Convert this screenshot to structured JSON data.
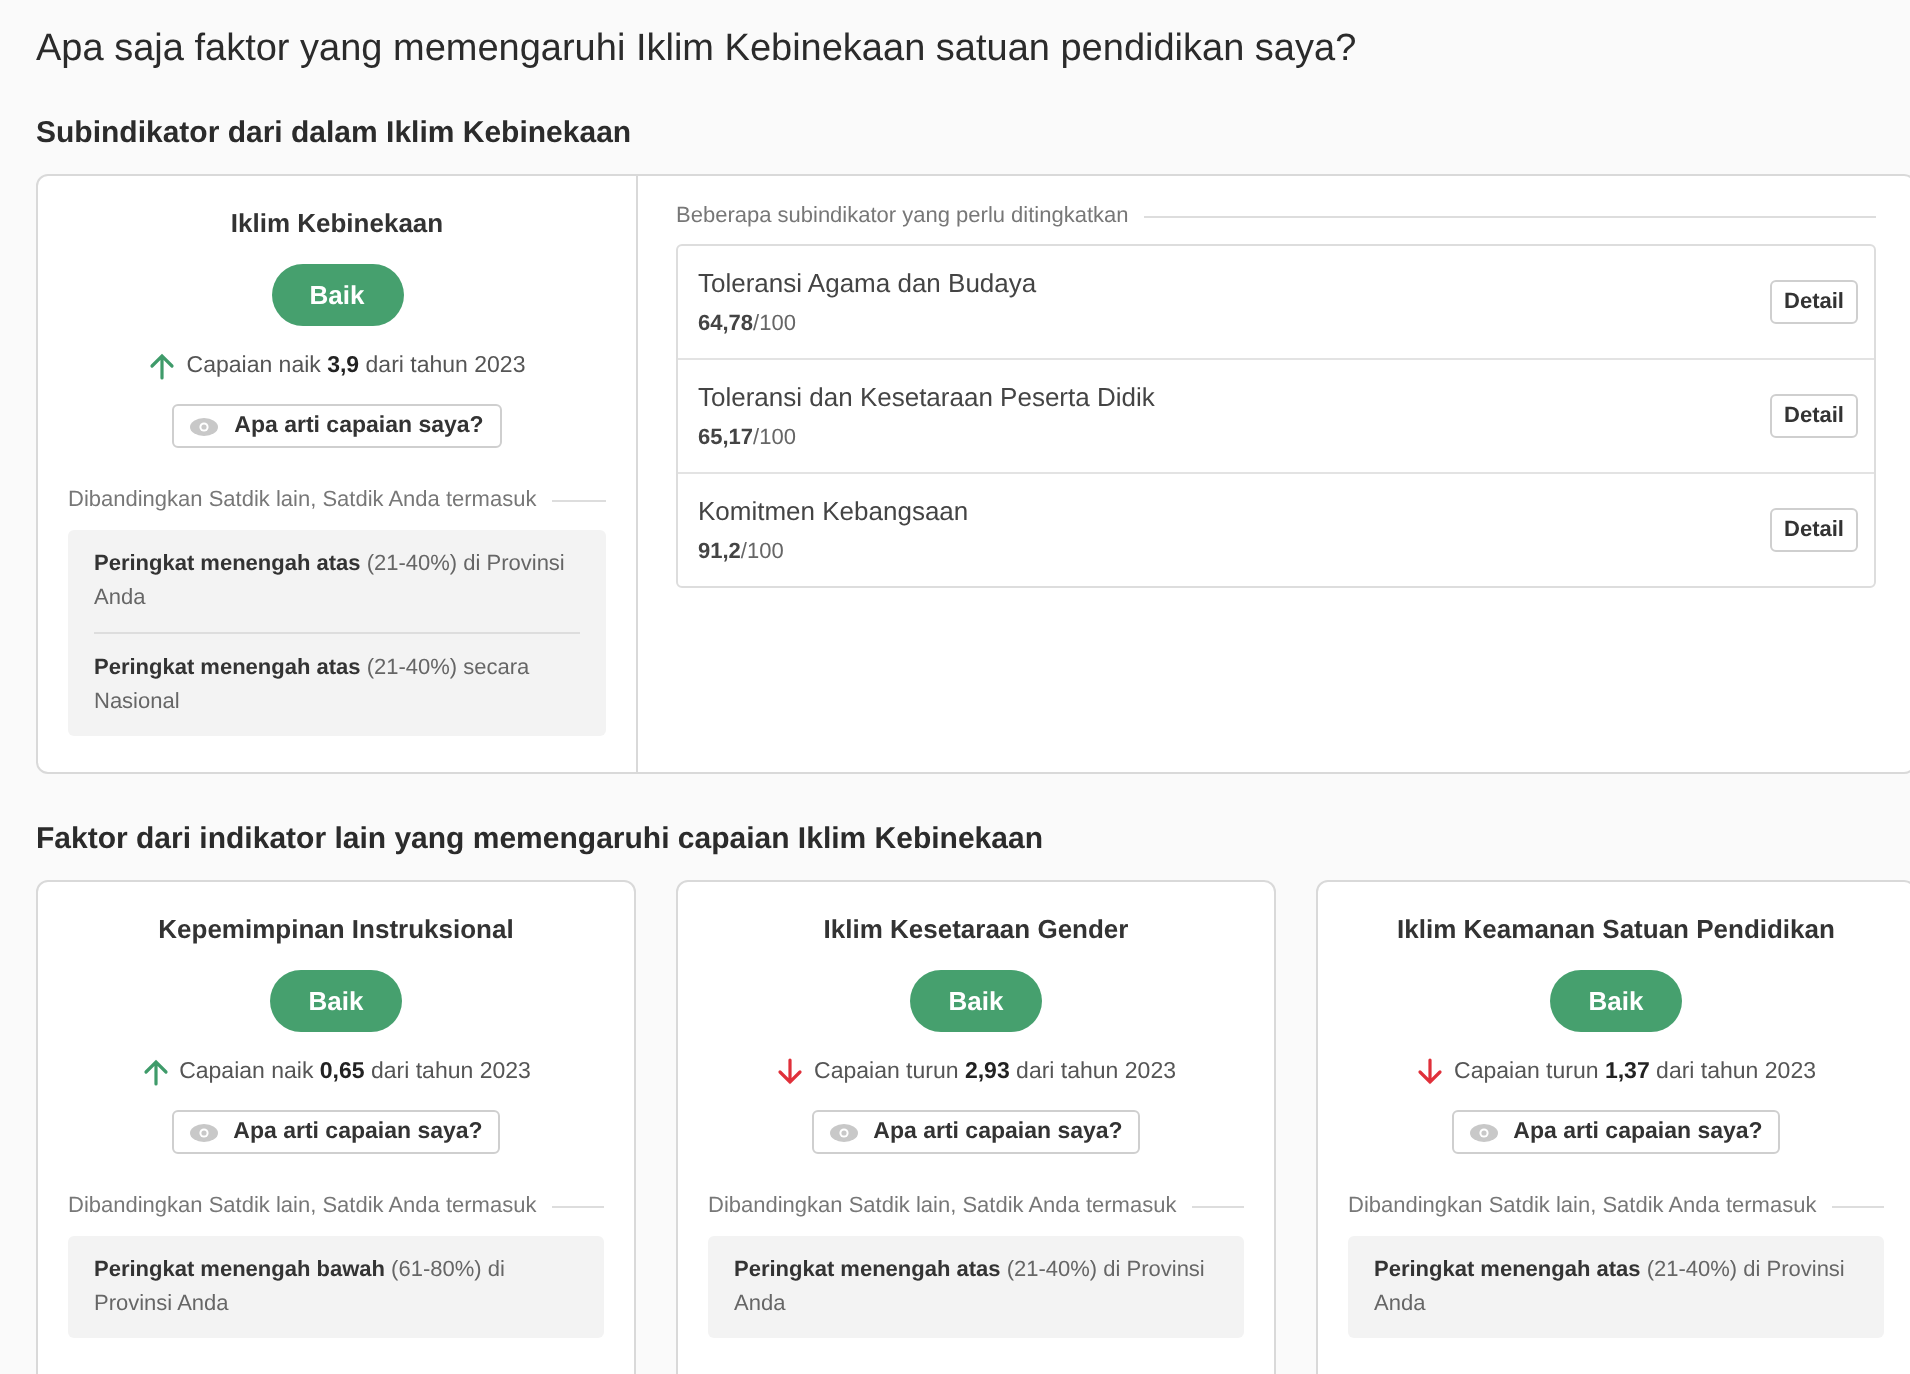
{
  "title": "Apa saja faktor yang memengaruhi Iklim Kebinekaan satuan pendidikan saya?",
  "sub_section": {
    "heading": "Subindikator dari dalam Iklim Kebinekaan",
    "summary": {
      "name": "Iklim Kebinekaan",
      "badge": "Baik",
      "kind": "up",
      "change": "Capaian naik **3,9** dari tahun 2023",
      "help_button": "Apa arti capaian saya?",
      "compare_label": "Dibandingkan Satdik lain, Satdik Anda termasuk",
      "ranks": [
        "**Peringkat menengah atas** (21-40%) di Provinsi Anda",
        "**Peringkat menengah atas** (21-40%) secara Nasional"
      ]
    },
    "list_label": "Beberapa subindikator yang perlu ditingkatkan",
    "items": [
      {
        "name": "Toleransi Agama dan Budaya",
        "score": "**64,78**/100",
        "button": "Detail"
      },
      {
        "name": "Toleransi dan Kesetaraan Peserta Didik",
        "score": "**65,17**/100",
        "button": "Detail"
      },
      {
        "name": "Komitmen Kebangsaan",
        "score": "**91,2**/100",
        "button": "Detail"
      }
    ]
  },
  "factors": {
    "heading": "Faktor dari indikator lain yang memengaruhi capaian Iklim Kebinekaan",
    "cards": [
      {
        "name": "Kepemimpinan Instruksional",
        "badge": "Baik",
        "kind": "up",
        "change": "Capaian naik **0,65** dari tahun 2023",
        "help_button": "Apa arti capaian saya?",
        "compare_label": "Dibandingkan Satdik lain, Satdik Anda termasuk",
        "ranks": [
          "**Peringkat menengah bawah** (61-80%) di Provinsi Anda"
        ]
      },
      {
        "name": "Iklim Kesetaraan Gender",
        "badge": "Baik",
        "kind": "down",
        "change": "Capaian turun **2,93** dari tahun 2023",
        "help_button": "Apa arti capaian saya?",
        "compare_label": "Dibandingkan Satdik lain, Satdik Anda termasuk",
        "ranks": [
          "**Peringkat menengah atas** (21-40%) di Provinsi Anda"
        ]
      },
      {
        "name": "Iklim Keamanan Satuan Pendidikan",
        "badge": "Baik",
        "kind": "down",
        "change": "Capaian turun **1,37** dari tahun 2023",
        "help_button": "Apa arti capaian saya?",
        "compare_label": "Dibandingkan Satdik lain, Satdik Anda termasuk",
        "ranks": [
          "**Peringkat menengah atas** (21-40%) di Provinsi Anda"
        ]
      }
    ]
  }
}
